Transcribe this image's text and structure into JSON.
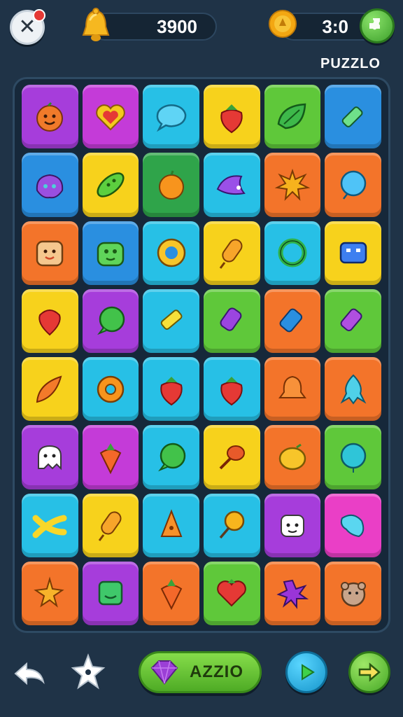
{
  "header": {
    "notification_count": "",
    "coins": "3900",
    "timer": "3:0",
    "title": "PUZZLO"
  },
  "footer": {
    "action_label": "AZZIO"
  },
  "colors": {
    "purple": "#a63ddb",
    "magenta": "#c43bd8",
    "cyan": "#27c0e6",
    "yellow": "#f7d21c",
    "green": "#5fc83a",
    "blue": "#2a8fe0",
    "orange": "#f3742a",
    "deepgreen": "#2fa44a",
    "pink": "#ea3fc6"
  },
  "board": {
    "rows": [
      [
        {
          "bg": "purple",
          "icon": "smiling-face-icon"
        },
        {
          "bg": "magenta",
          "icon": "heart-icon"
        },
        {
          "bg": "cyan",
          "icon": "speech-bubble-icon"
        },
        {
          "bg": "yellow",
          "icon": "strawberry-icon"
        },
        {
          "bg": "green",
          "icon": "leaf-icon"
        },
        {
          "bg": "blue",
          "icon": "crayon-icon"
        }
      ],
      [
        {
          "bg": "blue",
          "icon": "purple-blob-icon"
        },
        {
          "bg": "yellow",
          "icon": "green-bean-icon"
        },
        {
          "bg": "deepgreen",
          "icon": "orange-fruit-icon"
        },
        {
          "bg": "cyan",
          "icon": "purple-fish-icon"
        },
        {
          "bg": "orange",
          "icon": "splat-icon"
        },
        {
          "bg": "orange",
          "icon": "blue-balloon-icon"
        }
      ],
      [
        {
          "bg": "orange",
          "icon": "toast-face-icon"
        },
        {
          "bg": "blue",
          "icon": "green-monster-icon"
        },
        {
          "bg": "cyan",
          "icon": "cookie-bubble-icon"
        },
        {
          "bg": "yellow",
          "icon": "popsicle-icon"
        },
        {
          "bg": "cyan",
          "icon": "green-ring-icon"
        },
        {
          "bg": "yellow",
          "icon": "blue-cube-face-icon"
        }
      ],
      [
        {
          "bg": "yellow",
          "icon": "red-balloon-icon"
        },
        {
          "bg": "purple",
          "icon": "green-bubble-icon"
        },
        {
          "bg": "cyan",
          "icon": "yellow-crayon-icon"
        },
        {
          "bg": "green",
          "icon": "purple-popsicle-icon"
        },
        {
          "bg": "orange",
          "icon": "blue-crayon-icon"
        },
        {
          "bg": "green",
          "icon": "purple-crayon-icon"
        }
      ],
      [
        {
          "bg": "yellow",
          "icon": "orange-rocket-icon"
        },
        {
          "bg": "cyan",
          "icon": "donut-icon"
        },
        {
          "bg": "cyan",
          "icon": "strawberry-icon"
        },
        {
          "bg": "cyan",
          "icon": "strawberry-icon"
        },
        {
          "bg": "orange",
          "icon": "bell-icon"
        },
        {
          "bg": "orange",
          "icon": "squid-icon"
        }
      ],
      [
        {
          "bg": "purple",
          "icon": "ghost-icon"
        },
        {
          "bg": "magenta",
          "icon": "carrot-icon"
        },
        {
          "bg": "cyan",
          "icon": "green-bubble-icon"
        },
        {
          "bg": "yellow",
          "icon": "drumstick-icon"
        },
        {
          "bg": "orange",
          "icon": "lemon-icon"
        },
        {
          "bg": "green",
          "icon": "cyan-balloon-icon"
        }
      ],
      [
        {
          "bg": "cyan",
          "icon": "banana-cross-icon"
        },
        {
          "bg": "yellow",
          "icon": "popsicle-icon"
        },
        {
          "bg": "cyan",
          "icon": "orange-cone-icon"
        },
        {
          "bg": "cyan",
          "icon": "lollipop-icon"
        },
        {
          "bg": "purple",
          "icon": "dog-face-icon"
        },
        {
          "bg": "pink",
          "icon": "cyan-star-icon"
        }
      ],
      [
        {
          "bg": "orange",
          "icon": "orange-star-icon"
        },
        {
          "bg": "purple",
          "icon": "green-box-face-icon"
        },
        {
          "bg": "orange",
          "icon": "carrot-icon"
        },
        {
          "bg": "green",
          "icon": "heart-strawberry-icon"
        },
        {
          "bg": "orange",
          "icon": "purple-splat-icon"
        },
        {
          "bg": "orange",
          "icon": "bear-face-icon"
        }
      ]
    ]
  }
}
